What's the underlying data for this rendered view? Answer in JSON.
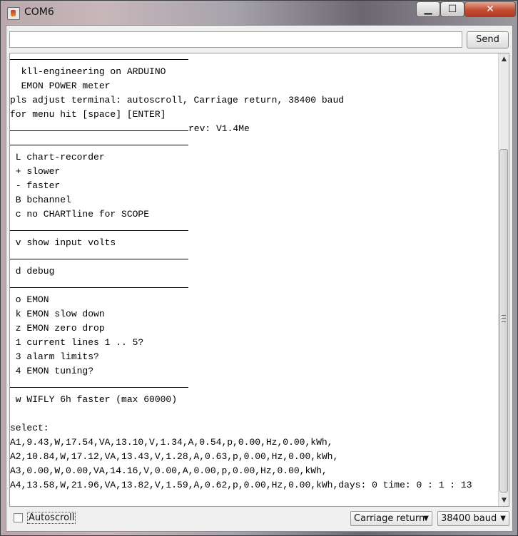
{
  "window": {
    "title": "COM6",
    "controls": {
      "minimize": "▁",
      "maximize": "☐",
      "close": "✕"
    }
  },
  "send_bar": {
    "input_value": "",
    "send_label": "Send"
  },
  "terminal": {
    "lines": [
      {
        "text": "",
        "rule": true
      },
      {
        "text": "  kll-engineering on ARDUINO"
      },
      {
        "text": "  EMON POWER meter"
      },
      {
        "text": "pls adjust terminal: autoscroll, Carriage return, 38400 baud"
      },
      {
        "text": "for menu hit [space] [ENTER]"
      },
      {
        "text": "rev: V1.4Me",
        "rule": true,
        "rule_text": true
      },
      {
        "text": "",
        "rule": true
      },
      {
        "text": " L chart-recorder"
      },
      {
        "text": " + slower"
      },
      {
        "text": " - faster"
      },
      {
        "text": " B bchannel"
      },
      {
        "text": " c no CHARTline for SCOPE"
      },
      {
        "text": "",
        "rule": true
      },
      {
        "text": " v show input volts"
      },
      {
        "text": "",
        "rule": true
      },
      {
        "text": " d debug"
      },
      {
        "text": "",
        "rule": true
      },
      {
        "text": " o EMON"
      },
      {
        "text": " k EMON slow down"
      },
      {
        "text": " z EMON zero drop"
      },
      {
        "text": " 1 current lines 1 .. 5?"
      },
      {
        "text": " 3 alarm limits?"
      },
      {
        "text": " 4 EMON tuning?"
      },
      {
        "text": "",
        "rule": true
      },
      {
        "text": " w WIFLY 6h faster (max 60000)"
      },
      {
        "text": ""
      },
      {
        "text": "select:"
      },
      {
        "text": "A1,9.43,W,17.54,VA,13.10,V,1.34,A,0.54,p,0.00,Hz,0.00,kWh,"
      },
      {
        "text": "A2,10.84,W,17.12,VA,13.43,V,1.28,A,0.63,p,0.00,Hz,0.00,kWh,"
      },
      {
        "text": "A3,0.00,W,0.00,VA,14.16,V,0.00,A,0.00,p,0.00,Hz,0.00,kWh,"
      },
      {
        "text": "A4,13.58,W,21.96,VA,13.82,V,1.59,A,0.62,p,0.00,Hz,0.00,kWh,days: 0 time: 0 : 1 : 13"
      }
    ]
  },
  "scrollbar": {
    "up_arrow": "▲",
    "down_arrow": "▼"
  },
  "footer": {
    "autoscroll_label": "Autoscroll",
    "autoscroll_checked": false,
    "line_ending": "Carriage return",
    "baud_rate": "38400 baud",
    "dropdown_arrow": "▼"
  }
}
